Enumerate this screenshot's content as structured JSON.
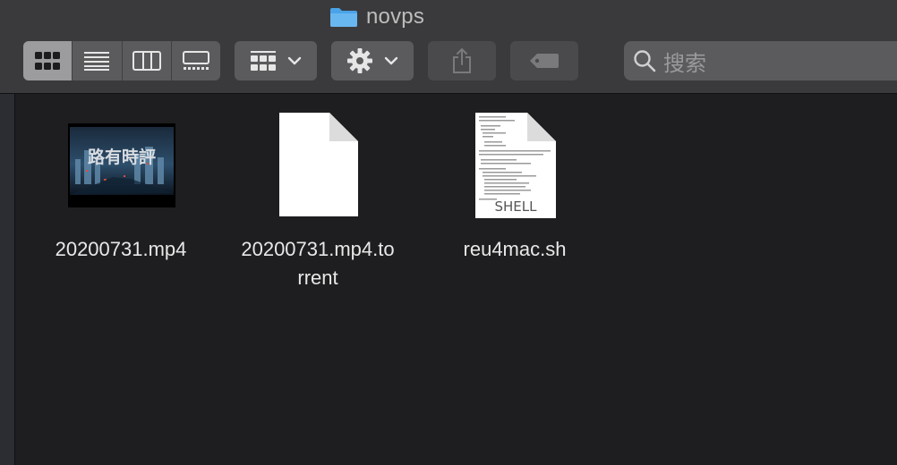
{
  "window": {
    "title": "novps"
  },
  "toolbar": {
    "view_modes": [
      {
        "name": "icon-view",
        "active": true
      },
      {
        "name": "list-view",
        "active": false
      },
      {
        "name": "column-view",
        "active": false
      },
      {
        "name": "gallery-view",
        "active": false
      }
    ],
    "group_button_icon": "grid-icon",
    "action_button_icon": "gear-icon",
    "share_button_icon": "share-icon",
    "tag_button_icon": "tag-icon",
    "search": {
      "placeholder": "搜索"
    }
  },
  "files": [
    {
      "name": "20200731.mp4",
      "kind": "video",
      "thumbnail_text": "路有時評"
    },
    {
      "name_line1": "20200731.mp4.to",
      "name_line2": "rrent",
      "kind": "document"
    },
    {
      "name": "reu4mac.sh",
      "kind": "shell",
      "badge": "SHELL"
    }
  ],
  "colors": {
    "window_bg": "#1e1e20",
    "toolbar_bg": "#3a3a3c",
    "button_bg": "#5b5b5e",
    "active_button_bg": "#9c9c9f",
    "folder_blue": "#4aa3e8"
  }
}
